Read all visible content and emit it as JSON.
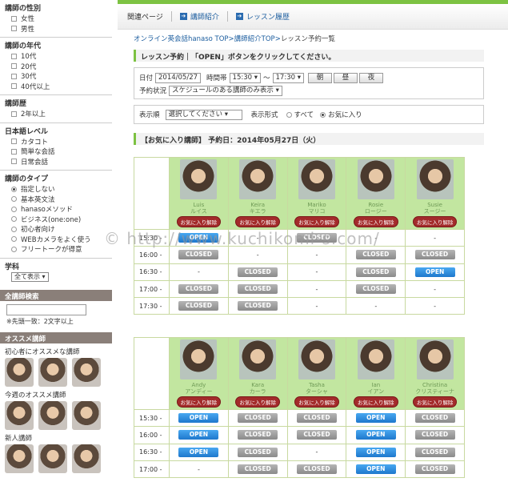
{
  "sidebar": {
    "gender": {
      "title": "講師の性別",
      "options": [
        "女性",
        "男性"
      ]
    },
    "age": {
      "title": "講師の年代",
      "options": [
        "10代",
        "20代",
        "30代",
        "40代以上"
      ]
    },
    "career": {
      "title": "講師歴",
      "options": [
        "2年以上"
      ]
    },
    "japanese": {
      "title": "日本語レベル",
      "options": [
        "カタコト",
        "簡単な会話",
        "日常会話"
      ]
    },
    "type": {
      "title": "講師のタイプ",
      "options": [
        "指定しない",
        "基本英文法",
        "hanasoメソッド",
        "ビジネス(one:one)",
        "初心者向け",
        "WEBカメラをよく使う",
        "フリートークが得意"
      ],
      "selected": 0
    },
    "subject": {
      "title": "学科",
      "select_value": "全て表示"
    },
    "search": {
      "band": "全講師検索",
      "note": "※先頭一致：2文字以上"
    },
    "recommend": {
      "band": "オススメ講師",
      "beginner_label": "初心者にオススメな講師",
      "weekly_label": "今週のオススメ講師",
      "new_label": "新人講師"
    }
  },
  "nav": {
    "items": [
      "関連ページ",
      "講師紹介",
      "レッスン履歴"
    ]
  },
  "breadcrumb": {
    "link1": "オンライン英会話hanaso TOP",
    "sep": ">",
    "link2": "講師紹介TOP",
    "current": "レッスン予約一覧"
  },
  "reserve": {
    "heading": "レッスン予約｜「OPEN」ボタンをクリックしてください。"
  },
  "form": {
    "date_label": "日付",
    "date_value": "2014/05/27",
    "time_label": "時間帯",
    "time_from": "15:30",
    "tilde": "〜",
    "time_to": "17:30",
    "btn_morning": "朝",
    "btn_noon": "昼",
    "btn_night": "夜",
    "status_label": "予約状況",
    "status_value": "スケジュールのある講師のみ表示"
  },
  "filter": {
    "order_label": "表示順",
    "order_value": "選択してください",
    "format_label": "表示形式",
    "opt_all": "すべて",
    "opt_fav": "お気に入り"
  },
  "fav_heading": "【お気に入り講師】 予約日：2014年05月27日（火）",
  "fav_label": "お気に入り解除",
  "open_label": "OPEN",
  "closed_label": "CLOSED",
  "watermark": "© http://www.kuchikomi-s.com/",
  "block1": {
    "names": [
      "Luis",
      "Keira",
      "Mariko",
      "Rosie",
      "Susie"
    ],
    "subnames": [
      "ルイス",
      "キエラ",
      "マリコ",
      "ロージー",
      "スージー"
    ],
    "rows": [
      {
        "time": "15:30 -",
        "cells": [
          "OPEN",
          "-",
          "CLOSED",
          "-",
          "-"
        ]
      },
      {
        "time": "16:00 -",
        "cells": [
          "CLOSED",
          "-",
          "-",
          "CLOSED",
          "CLOSED"
        ]
      },
      {
        "time": "16:30 -",
        "cells": [
          "-",
          "CLOSED",
          "-",
          "CLOSED",
          "OPEN"
        ]
      },
      {
        "time": "17:00 -",
        "cells": [
          "CLOSED",
          "CLOSED",
          "-",
          "CLOSED",
          "-"
        ]
      },
      {
        "time": "17:30 -",
        "cells": [
          "CLOSED",
          "CLOSED",
          "-",
          "-",
          "-"
        ]
      }
    ]
  },
  "block2": {
    "names": [
      "Andy",
      "Kara",
      "Tasha",
      "Ian",
      "Christina"
    ],
    "subnames": [
      "アンディー",
      "カーラ",
      "ターシャ",
      "イアン",
      "クリスティーナ"
    ],
    "rows": [
      {
        "time": "15:30 -",
        "cells": [
          "OPEN",
          "CLOSED",
          "CLOSED",
          "OPEN",
          "CLOSED"
        ]
      },
      {
        "time": "16:00 -",
        "cells": [
          "OPEN",
          "CLOSED",
          "CLOSED",
          "OPEN",
          "CLOSED"
        ]
      },
      {
        "time": "16:30 -",
        "cells": [
          "OPEN",
          "CLOSED",
          "-",
          "OPEN",
          "CLOSED"
        ]
      },
      {
        "time": "17:00 -",
        "cells": [
          "-",
          "CLOSED",
          "CLOSED",
          "OPEN",
          "CLOSED"
        ]
      }
    ]
  }
}
